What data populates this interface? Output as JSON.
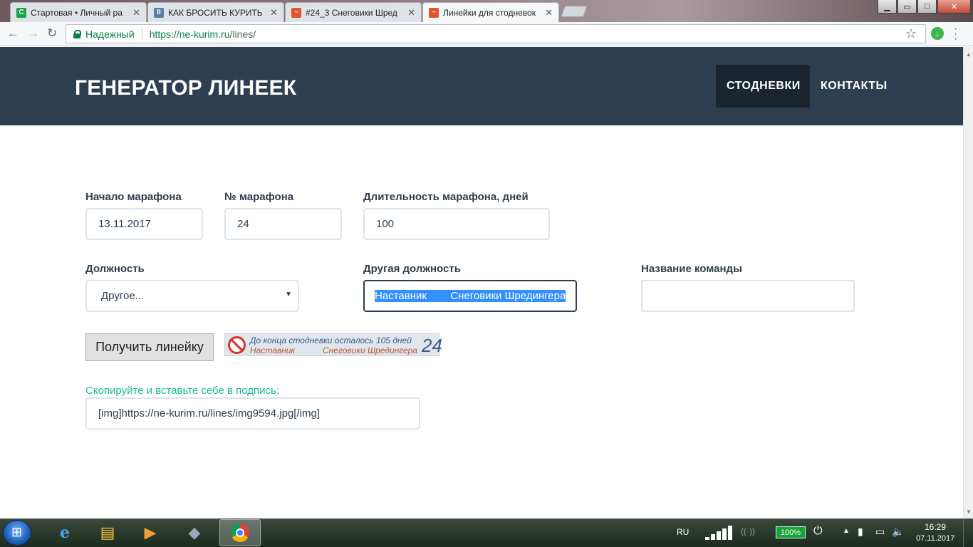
{
  "browser": {
    "tabs": [
      {
        "title": "Стартовая • Личный ра",
        "favicon_color": "#1aa34a",
        "favicon_letter": "C"
      },
      {
        "title": "КАК БРОСИТЬ КУРИТЬ",
        "favicon_color": "#5b7fa6",
        "favicon_letter": "II"
      },
      {
        "title": "#24_3 Снеговики Шред",
        "favicon_color": "#e5532d",
        "favicon_letter": "~"
      },
      {
        "title": "Линейки для стодневок",
        "favicon_color": "#e5532d",
        "favicon_letter": "~"
      }
    ],
    "active_tab": 3,
    "secure_label": "Надежный",
    "url_host": "https://ne-kurim.ru",
    "url_path": "/lines/"
  },
  "header": {
    "title": "ГЕНЕРАТОР ЛИНЕЕК",
    "nav": [
      {
        "label": "СТОДНЕВКИ",
        "active": true
      },
      {
        "label": "КОНТАКТЫ",
        "active": false
      }
    ],
    "bg_color": "#2c3e50"
  },
  "form": {
    "start_date": {
      "label": "Начало марафона",
      "value": "13.11.2017"
    },
    "marathon_no": {
      "label": "№ марафона",
      "value": "24"
    },
    "duration": {
      "label": "Длительность марафона, дней",
      "value": "100"
    },
    "position": {
      "label": "Должность",
      "value": "Другое..."
    },
    "other_position": {
      "label": "Другая должность",
      "value": "Наставник        Снеговики Шредингера"
    },
    "team_name": {
      "label": "Название команды",
      "value": ""
    },
    "submit_label": "Получить линейку"
  },
  "banner": {
    "line1": "До конца стодневки осталось 105 дней",
    "role": "Наставник",
    "team": "Снеговики Шредингера",
    "number": "24"
  },
  "output": {
    "label": "Скопируйте и вставьте себе в подпись:",
    "code": "[img]https://ne-kurim.ru/lines/img9594.jpg[/img]"
  },
  "taskbar": {
    "language": "RU",
    "battery": "100%",
    "time": "16:29",
    "date": "07.11.2017"
  }
}
